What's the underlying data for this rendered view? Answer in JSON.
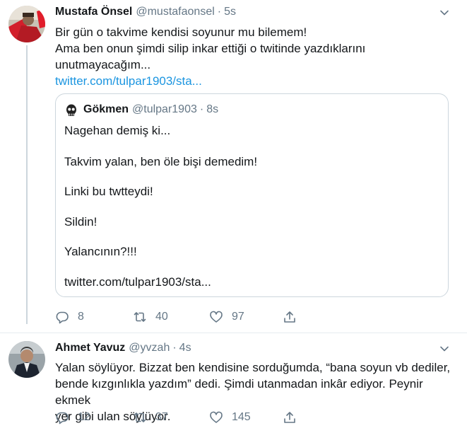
{
  "tweet1": {
    "name": "Mustafa Önsel",
    "handle": "@mustafaonsel",
    "separator": "·",
    "time": "5s",
    "lines": [
      "Bir gün o takvime kendisi soyunur mu bilemem!",
      "Ama ben onun şimdi silip inkar ettiği o twitinde yazdıklarını",
      "unutmayacağım..."
    ],
    "link": "twitter.com/tulpar1903/sta...",
    "quote": {
      "name": "Gökmen",
      "handle": "@tulpar1903",
      "separator": "·",
      "time": "8s",
      "lines": [
        "Nagehan demiş ki...",
        "Takvim yalan, ben öle bişi demedim!",
        "Linki bu twtteydi!",
        "Sildin!",
        "Yalancının?!!!",
        "twitter.com/tulpar1903/sta..."
      ]
    },
    "actions": {
      "reply_count": "8",
      "retweet_count": "40",
      "like_count": "97"
    }
  },
  "tweet2": {
    "name": "Ahmet Yavuz",
    "handle": "@yvzah",
    "separator": "·",
    "time": "4s",
    "lines": [
      "Yalan söylüyor. Bizzat ben kendisine sorduğumda, “bana soyun vb dediler,",
      "bende kızgınlıkla yazdım” dedi. Şimdi utanmadan inkâr ediyor. Peynir ekmek",
      "yer gibi ulan söylüyor."
    ],
    "actions": {
      "reply_count": "12",
      "retweet_count": "37",
      "like_count": "145"
    }
  },
  "colors": {
    "text": "#14171a",
    "secondary": "#657786",
    "link": "#1b95e0",
    "border": "#ccd6dd"
  },
  "icons": [
    "chevron-down-icon",
    "reply-icon",
    "retweet-icon",
    "like-icon",
    "share-icon"
  ]
}
